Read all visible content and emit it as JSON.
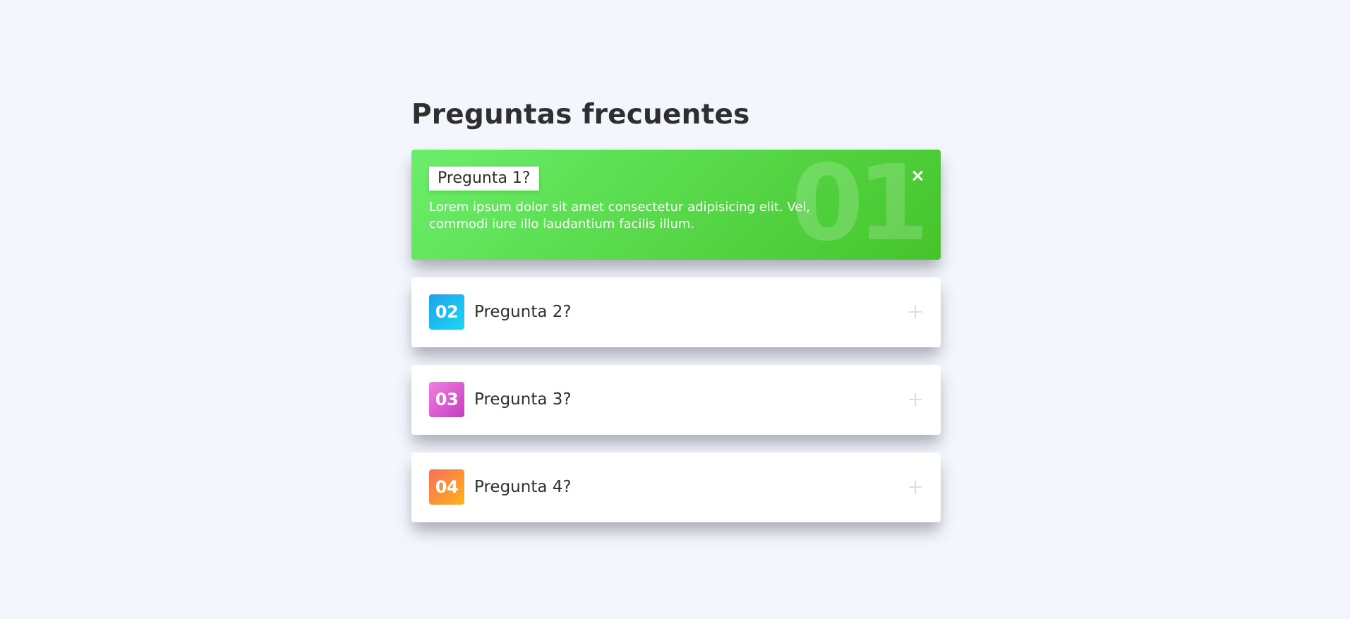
{
  "page": {
    "title": "Preguntas frecuentes",
    "background": "#f3f7fd"
  },
  "faq": {
    "items": [
      {
        "number": "01",
        "question": "Pregunta 1?",
        "answer": "Lorem ipsum dolor sit amet consectetur adipisicing elit. Vel, commodi iure illo laudantium facilis illum.",
        "expanded": true,
        "gradient": [
          "#6bee6b",
          "#45c42a"
        ],
        "toggle_icon": "close-icon"
      },
      {
        "number": "02",
        "question": "Pregunta 2?",
        "expanded": false,
        "gradient": [
          "#1fa2ee",
          "#1ed6f0"
        ],
        "toggle_icon": "plus-icon"
      },
      {
        "number": "03",
        "question": "Pregunta 3?",
        "expanded": false,
        "gradient": [
          "#f27fe0",
          "#c43ec0"
        ],
        "toggle_icon": "plus-icon"
      },
      {
        "number": "04",
        "question": "Pregunta 4?",
        "expanded": false,
        "gradient": [
          "#f6705a",
          "#ffb21a"
        ],
        "toggle_icon": "plus-icon"
      }
    ]
  }
}
